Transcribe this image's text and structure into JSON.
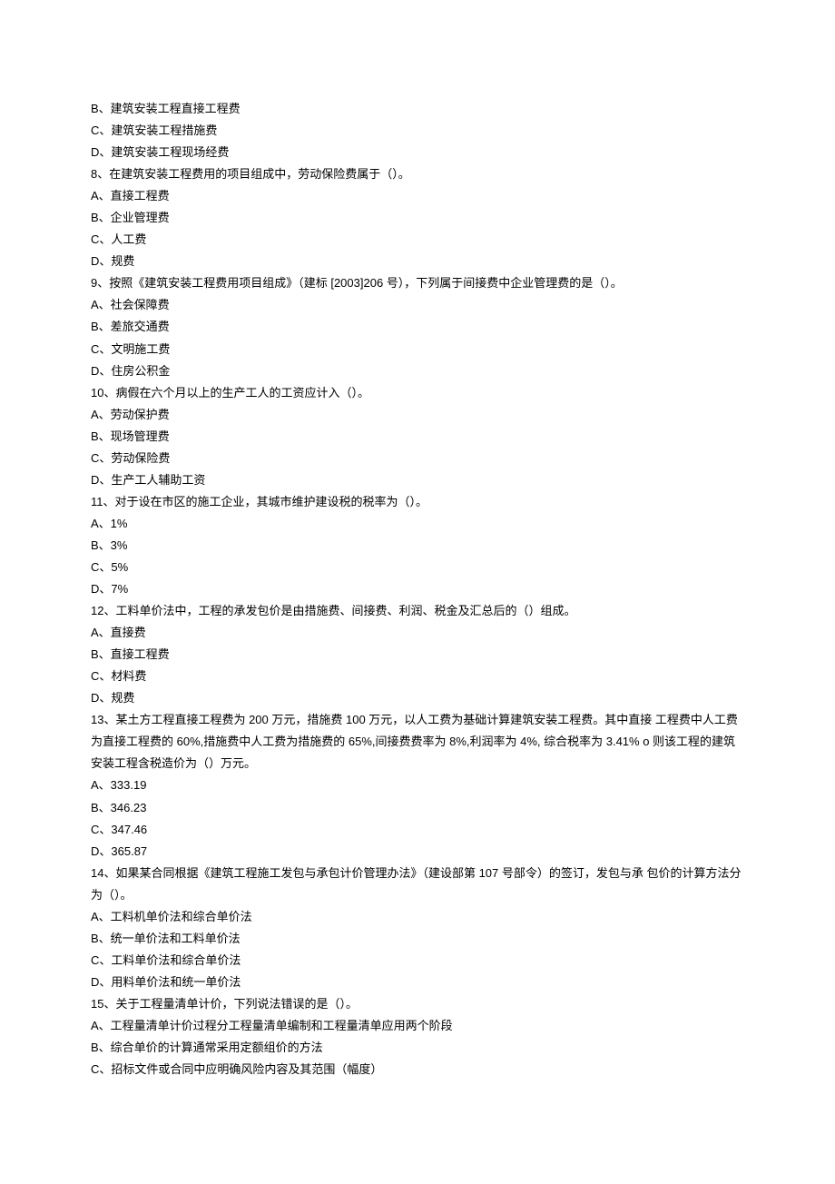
{
  "lines": [
    "B、建筑安装工程直接工程费",
    "C、建筑安装工程措施费",
    "D、建筑安装工程现场经费",
    "8、在建筑安装工程费用的项目组成中，劳动保险费属于（）。",
    "A、直接工程费",
    "B、企业管理费",
    "C、人工费",
    "D、规费",
    "9、按照《建筑安装工程费用项目组成》（建标  [2003]206 号），下列属于间接费中企业管理费的是（）。",
    "A、社会保障费",
    "B、差旅交通费",
    "C、文明施工费",
    "D、住房公积金",
    "10、病假在六个月以上的生产工人的工资应计入（）。",
    "A、劳动保护费",
    "B、现场管理费",
    "C、劳动保险费",
    "D、生产工人辅助工资",
    "11、对于设在市区的施工企业，其城市维护建设税的税率为（）。",
    "A、1%",
    "B、3%",
    "C、5%",
    "D、7%",
    "12、工料单价法中，工程的承发包价是由措施费、间接费、利润、税金及汇总后的（）组成。",
    "A、直接费",
    "B、直接工程费",
    "C、材料费",
    "D、规费",
    "13、某土方工程直接工程费为  200 万元，措施费 100 万元，以人工费为基础计算建筑安装工程费。其中直接  工程费中人工费为直接工程费的 60%,措施费中人工费为措施费的 65%,间接费费率为 8%,利润率为 4%, 综合税率为 3.41% o 则该工程的建筑安装工程含税造价为（）万元。",
    "A、333.19",
    "B、346.23",
    "C、347.46",
    "D、365.87",
    "14、如果某合同根据《建筑工程施工发包与承包计价管理办法》（建设部第 107 号部令）的签订，发包与承  包价的计算方法分为（）。",
    "A、工料机单价法和综合单价法",
    "B、统一单价法和工料单价法",
    "C、工料单价法和综合单价法",
    "D、用料单价法和统一单价法",
    "15、关于工程量清单计价，下列说法错误的是（）。",
    "A、工程量清单计价过程分工程量清单编制和工程量清单应用两个阶段",
    "B、综合单价的计算通常采用定额组价的方法",
    "C、招标文件或合同中应明确风险内容及其范围（幅度）"
  ]
}
